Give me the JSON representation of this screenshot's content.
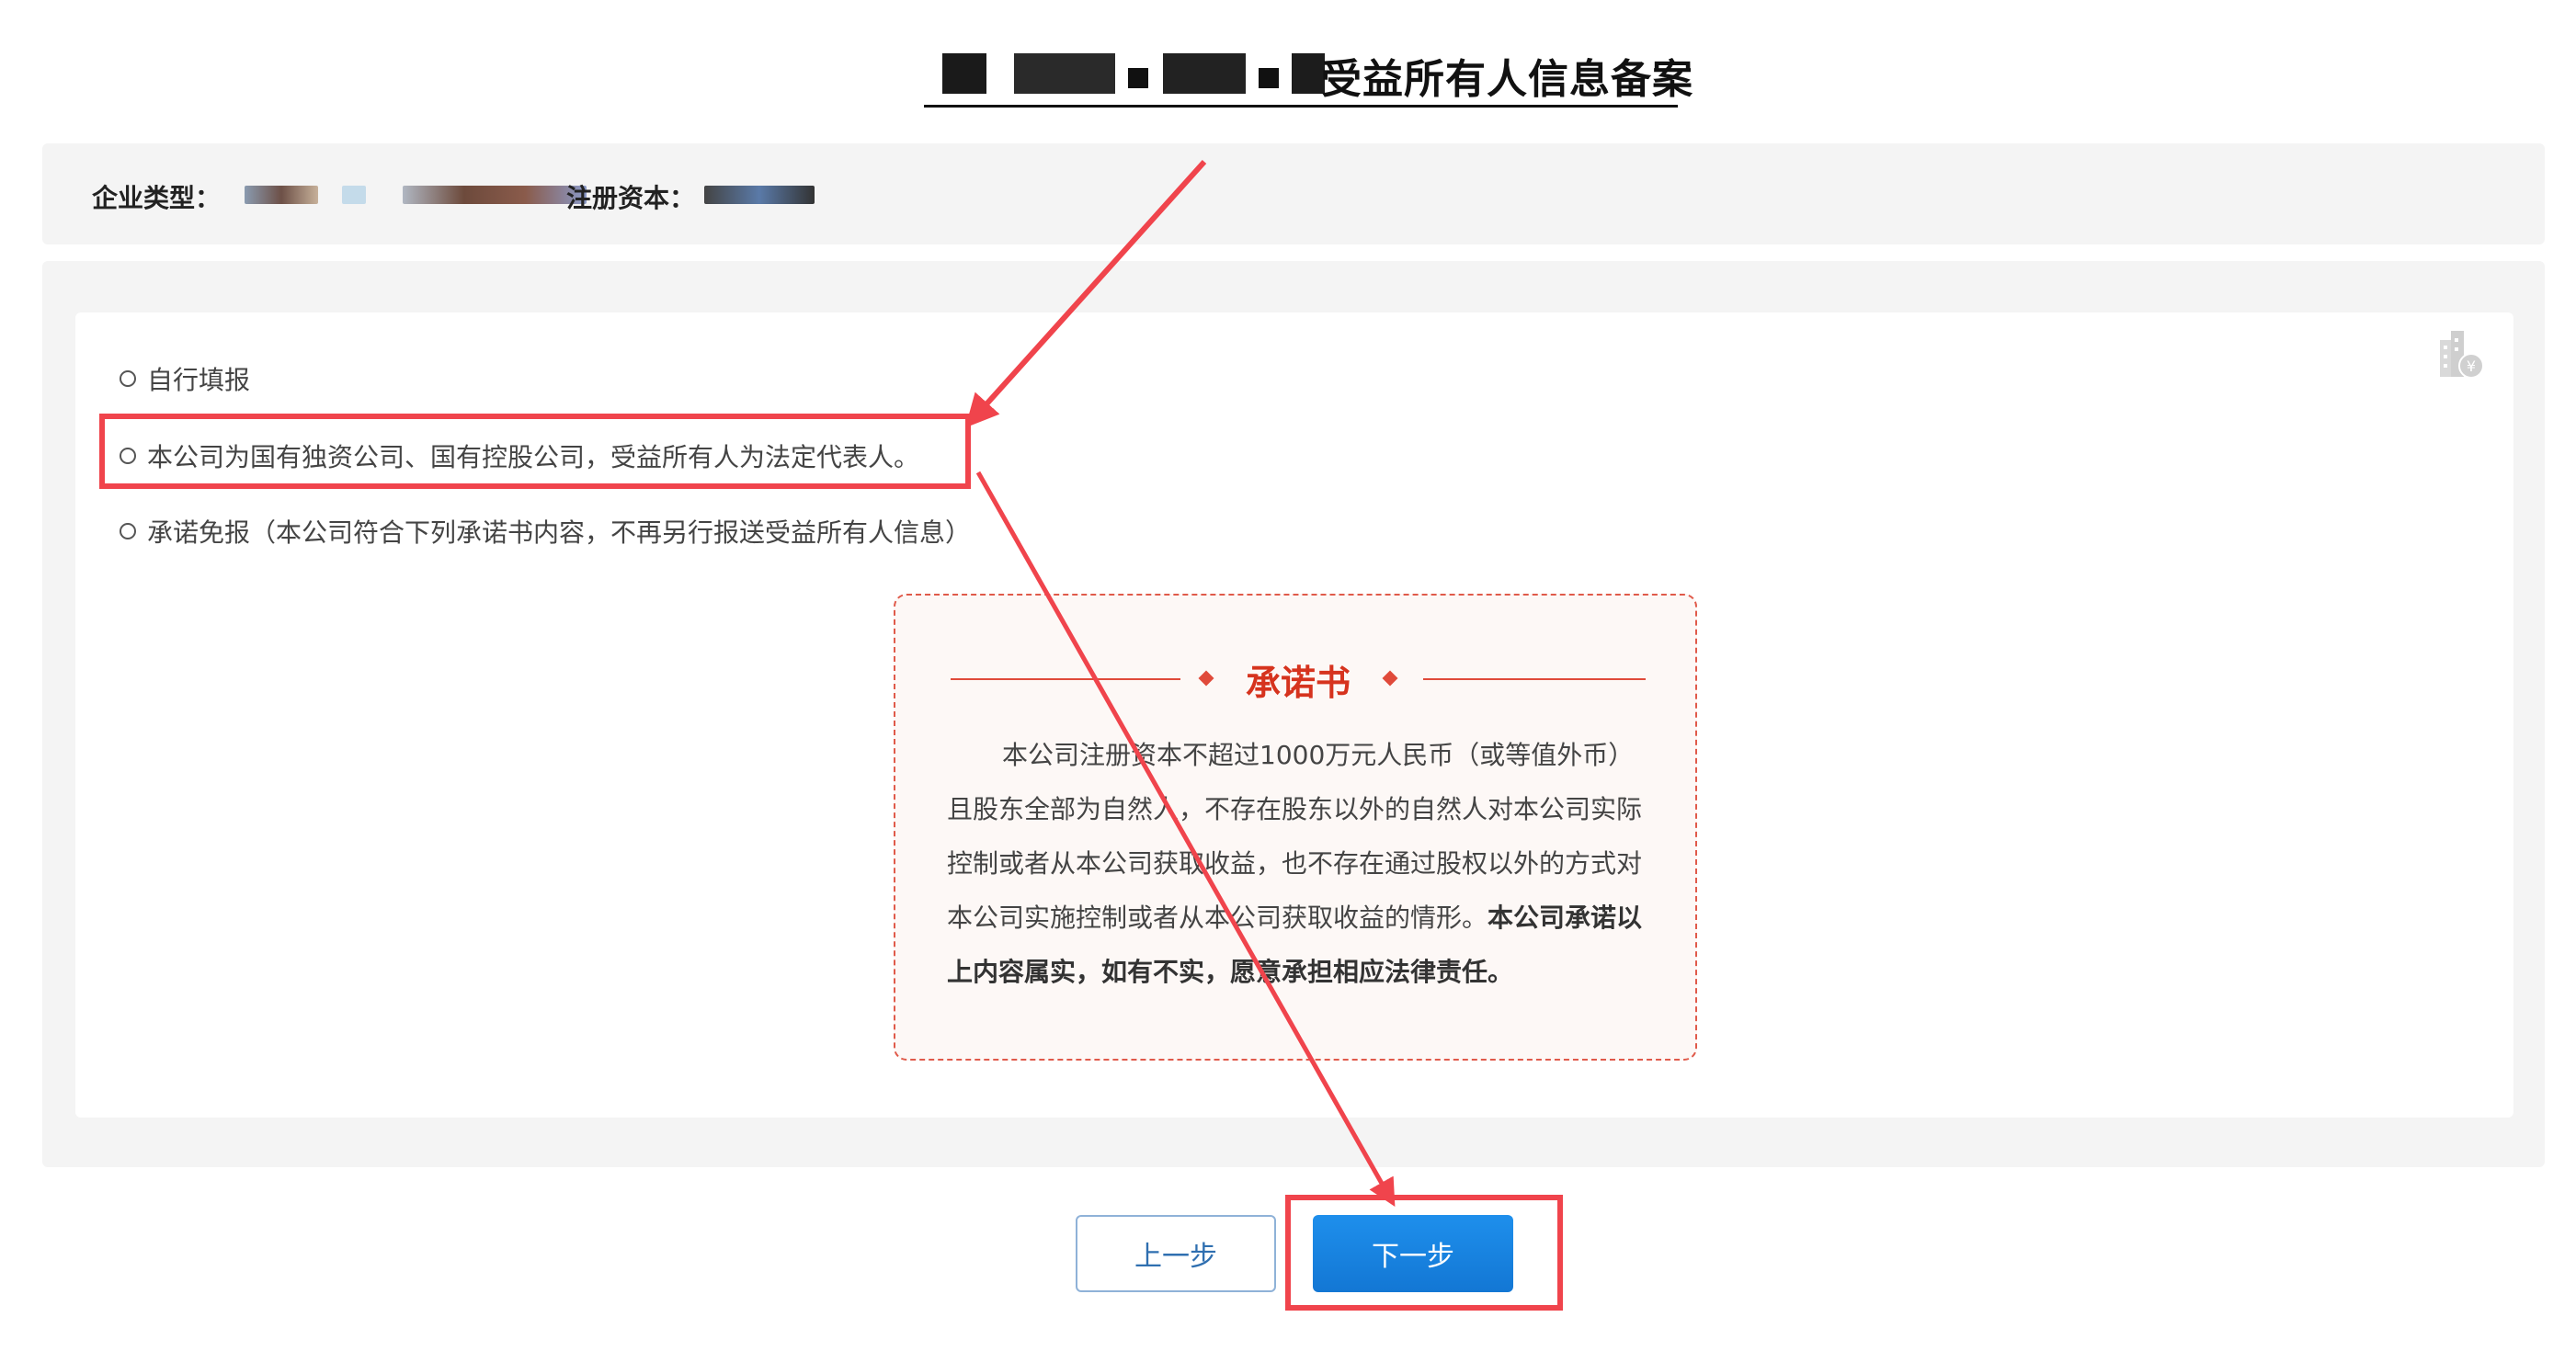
{
  "header": {
    "title": "受益所有人信息备案"
  },
  "info": {
    "type_label": "企业类型：",
    "capital_label": "注册资本："
  },
  "options": [
    {
      "label": "自行填报"
    },
    {
      "label": "本公司为国有独资公司、国有控股公司，受益所有人为法定代表人。"
    },
    {
      "label": "承诺免报（本公司符合下列承诺书内容，不再另行报送受益所有人信息）"
    }
  ],
  "pledge": {
    "title": "承诺书",
    "body": "本公司注册资本不超过1000万元人民币（或等值外币）且股东全部为自然人，不存在股东以外的自然人对本公司实际控制或者从本公司获取收益，也不存在通过股权以外的方式对本公司实施控制或者从本公司获取收益的情形。",
    "body_bold": "本公司承诺以上内容属实，如有不实，愿意承担相应法律责任。"
  },
  "buttons": {
    "prev": "上一步",
    "next": "下一步"
  },
  "colors": {
    "accent": "#1e88e5",
    "annotation": "#f0444c",
    "pledge_red": "#d6331e"
  },
  "icons": {
    "corner": "building-yuan-icon"
  }
}
